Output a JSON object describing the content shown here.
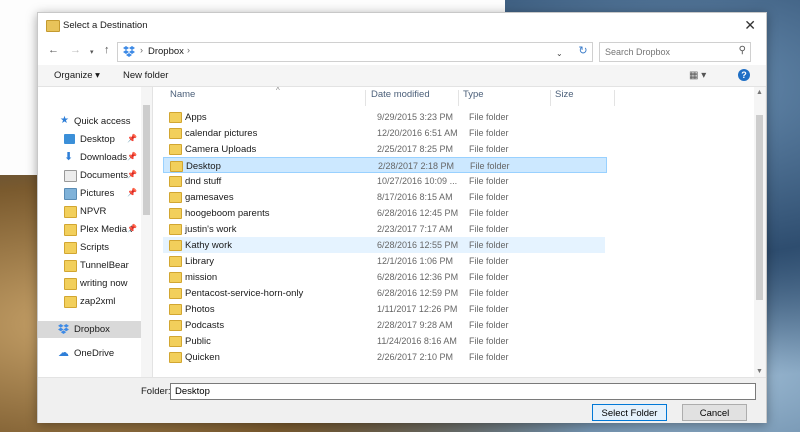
{
  "dialog": {
    "title": "Select a Destination",
    "close_icon": "close-icon"
  },
  "nav": {
    "back_icon": "back-arrow-icon",
    "forward_icon": "forward-arrow-icon",
    "recent_icon": "chevron-down-icon",
    "up_icon": "up-arrow-icon",
    "breadcrumb": [
      "Dropbox"
    ],
    "refresh_icon": "refresh-icon",
    "search_placeholder": "Search Dropbox",
    "search_icon": "search-icon"
  },
  "toolbar": {
    "organize": "Organize ▾",
    "new_folder": "New folder",
    "view_icon": "view-options-icon",
    "help": "?"
  },
  "sidebar": {
    "items": [
      {
        "label": "Quick access",
        "icon": "star-icon",
        "pinned": false
      },
      {
        "label": "Desktop",
        "icon": "desktop-icon",
        "pinned": true
      },
      {
        "label": "Downloads",
        "icon": "download-icon",
        "pinned": true
      },
      {
        "label": "Documents",
        "icon": "documents-icon",
        "pinned": true
      },
      {
        "label": "Pictures",
        "icon": "pictures-icon",
        "pinned": true
      },
      {
        "label": "NPVR",
        "icon": "folder-icon",
        "pinned": false
      },
      {
        "label": "Plex Media S",
        "icon": "folder-icon",
        "pinned": true
      },
      {
        "label": "Scripts",
        "icon": "folder-icon",
        "pinned": false
      },
      {
        "label": "TunnelBear",
        "icon": "folder-icon",
        "pinned": false
      },
      {
        "label": "writing now",
        "icon": "folder-icon",
        "pinned": false
      },
      {
        "label": "zap2xml",
        "icon": "folder-icon",
        "pinned": false
      },
      {
        "label": "Dropbox",
        "icon": "dropbox-icon",
        "pinned": false
      },
      {
        "label": "OneDrive",
        "icon": "onedrive-icon",
        "pinned": false
      }
    ]
  },
  "columns": {
    "name": "Name",
    "date": "Date modified",
    "type": "Type",
    "size": "Size"
  },
  "files": [
    {
      "name": "Apps",
      "date": "9/29/2015 3:23 PM",
      "type": "File folder"
    },
    {
      "name": "calendar pictures",
      "date": "12/20/2016 6:51 AM",
      "type": "File folder"
    },
    {
      "name": "Camera Uploads",
      "date": "2/25/2017 8:25 PM",
      "type": "File folder"
    },
    {
      "name": "Desktop",
      "date": "2/28/2017 2:18 PM",
      "type": "File folder"
    },
    {
      "name": "dnd stuff",
      "date": "10/27/2016 10:09 ...",
      "type": "File folder"
    },
    {
      "name": "gamesaves",
      "date": "8/17/2016 8:15 AM",
      "type": "File folder"
    },
    {
      "name": "hoogeboom parents",
      "date": "6/28/2016 12:45 PM",
      "type": "File folder"
    },
    {
      "name": "justin's work",
      "date": "2/23/2017 7:17 AM",
      "type": "File folder"
    },
    {
      "name": "Kathy work",
      "date": "6/28/2016 12:55 PM",
      "type": "File folder"
    },
    {
      "name": "Library",
      "date": "12/1/2016 1:06 PM",
      "type": "File folder"
    },
    {
      "name": "mission",
      "date": "6/28/2016 12:36 PM",
      "type": "File folder"
    },
    {
      "name": "Pentacost-service-horn-only",
      "date": "6/28/2016 12:59 PM",
      "type": "File folder"
    },
    {
      "name": "Photos",
      "date": "1/11/2017 12:26 PM",
      "type": "File folder"
    },
    {
      "name": "Podcasts",
      "date": "2/28/2017 9:28 AM",
      "type": "File folder"
    },
    {
      "name": "Public",
      "date": "11/24/2016 8:16 AM",
      "type": "File folder"
    },
    {
      "name": "Quicken",
      "date": "2/26/2017 2:10 PM",
      "type": "File folder"
    }
  ],
  "selected_index": 3,
  "hover_index": 8,
  "bottom": {
    "folder_label": "Folder:",
    "folder_value": "Desktop",
    "select_button": "Select Folder",
    "cancel_button": "Cancel"
  }
}
